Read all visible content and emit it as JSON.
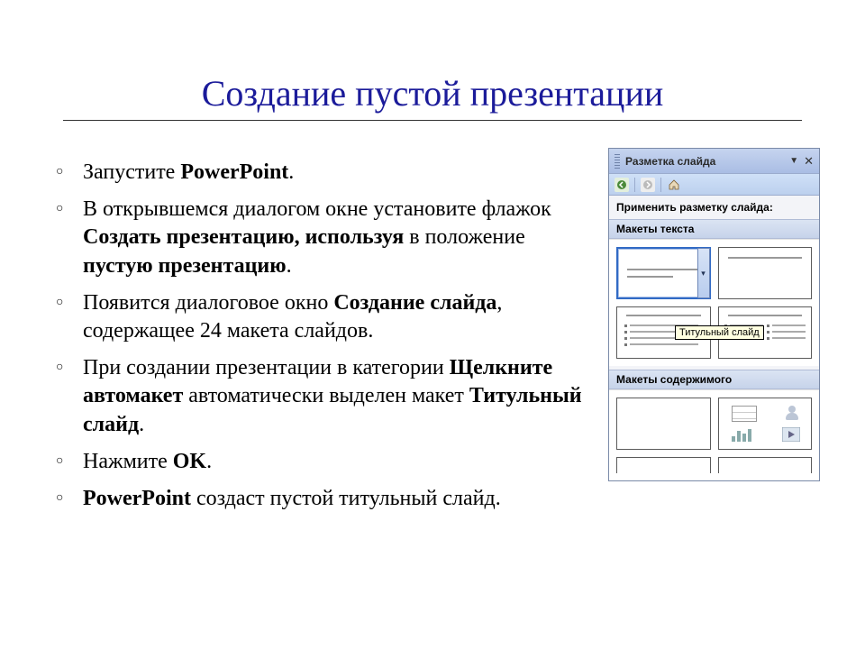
{
  "title": "Создание пустой презентации",
  "bullets": [
    {
      "html": "Запустите <b>PowerPoint</b>."
    },
    {
      "html": "В открывшемся диалогом окне установите флажок <b>Создать презентацию, используя</b> в положение <b>пустую презентацию</b>."
    },
    {
      "html": "Появится диалоговое окно <b>Создание слайда</b>, содержащее 24 макета слайдов."
    },
    {
      "html": "При создании презентации в категории <b>Щелкните автомакет</b> автоматически выделен макет <b>Титульный слайд</b>."
    },
    {
      "html": "Нажмите <b>OK</b>."
    },
    {
      "html": "<b>PowerPoint</b> создаст пустой титульный слайд."
    }
  ],
  "taskpane": {
    "title": "Разметка слайда",
    "apply_label": "Применить разметку слайда:",
    "section_text": "Макеты текста",
    "section_content": "Макеты содержимого",
    "tooltip": "Титульный слайд"
  }
}
